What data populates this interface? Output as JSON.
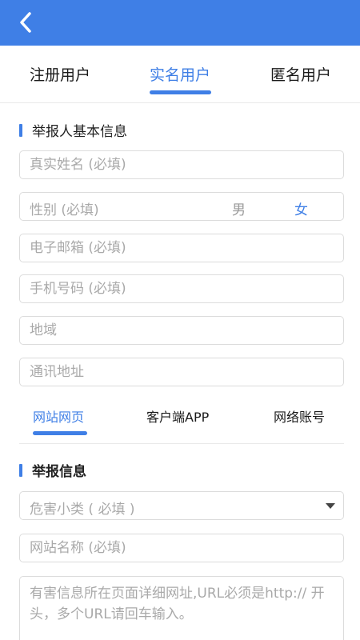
{
  "header": {
    "back_icon": "chevron-left-icon",
    "bg_color": "#3f7fe6"
  },
  "user_tabs": [
    {
      "label": "注册用户",
      "active": false
    },
    {
      "label": "实名用户",
      "active": true
    },
    {
      "label": "匿名用户",
      "active": false
    }
  ],
  "basic_info": {
    "title": "举报人基本信息",
    "name_placeholder": "真实姓名 (必填)",
    "gender_label": "性别 (必填)",
    "gender_male": "男",
    "gender_female": "女",
    "gender_selected": "女",
    "email_placeholder": "电子邮箱 (必填)",
    "phone_placeholder": "手机号码 (必填)",
    "region_placeholder": "地域",
    "address_placeholder": "通讯地址"
  },
  "site_tabs": [
    {
      "label": "网站网页",
      "active": true
    },
    {
      "label": "客户端APP",
      "active": false
    },
    {
      "label": "网络账号",
      "active": false
    }
  ],
  "report_info": {
    "title": "举报信息",
    "category_placeholder": "危害小类 ( 必填 )",
    "site_name_placeholder": "网站名称 (必填)",
    "url_placeholder": "有害信息所在页面详细网址,URL必须是http:// 开头，多个URL请回车输入。"
  },
  "accent_color": "#3f7fe6"
}
